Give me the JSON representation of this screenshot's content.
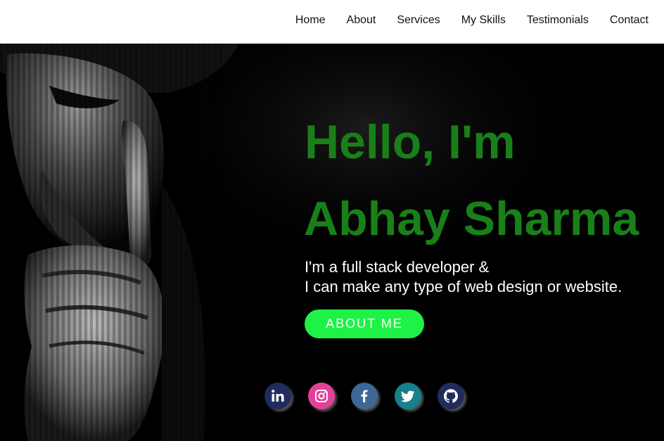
{
  "nav": {
    "items": [
      "Home",
      "About",
      "Services",
      "My Skills",
      "Testimonials",
      "Contact"
    ]
  },
  "hero": {
    "greeting": "Hello, I'm",
    "name": "Abhay Sharma",
    "description_line1": "I'm a full stack developer &",
    "description_line2": "I can make any type of web design or website.",
    "cta_label": "ABOUT ME"
  },
  "socials": [
    {
      "name": "linkedin-icon",
      "color": "#1f2c5c"
    },
    {
      "name": "instagram-icon",
      "color": "#e4409a"
    },
    {
      "name": "facebook-icon",
      "color": "#3c6796"
    },
    {
      "name": "twitter-icon",
      "color": "#16808c"
    },
    {
      "name": "github-icon",
      "color": "#1f2c5c"
    }
  ],
  "colors": {
    "heading_green": "#198019",
    "button_green": "#1ff246",
    "hero_background": "#000000"
  }
}
